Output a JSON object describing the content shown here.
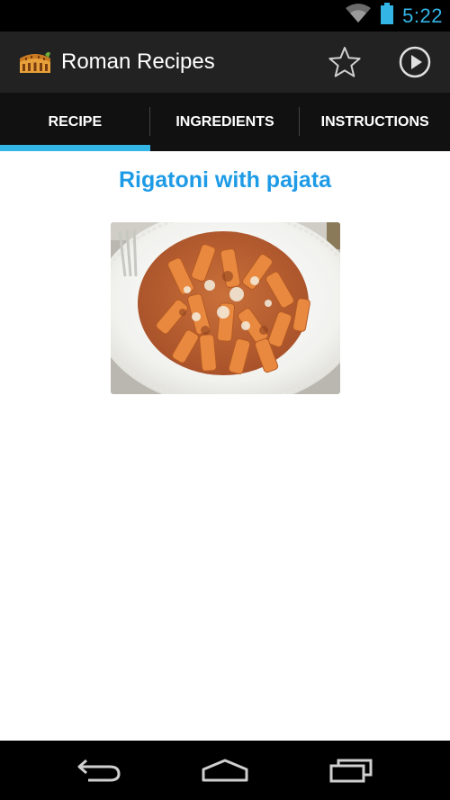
{
  "status_bar": {
    "time": "5:22",
    "icons": [
      "wifi-icon",
      "battery-icon"
    ]
  },
  "action_bar": {
    "app_icon": "colosseum-icon",
    "title": "Roman Recipes",
    "actions": [
      "star-icon",
      "play-icon"
    ]
  },
  "tabs": [
    {
      "label": "RECIPE",
      "selected": true
    },
    {
      "label": "INGREDIENTS",
      "selected": false
    },
    {
      "label": "INSTRUCTIONS",
      "selected": false
    }
  ],
  "recipe": {
    "title": "Rigatoni with pajata",
    "image": "rigatoni-dish-photo"
  },
  "nav_bar": {
    "buttons": [
      "back-icon",
      "home-icon",
      "recent-apps-icon"
    ]
  },
  "colors": {
    "accent": "#33b5e5",
    "title": "#1e9be6",
    "action_bar": "#222222",
    "tab_bar": "#111111"
  }
}
